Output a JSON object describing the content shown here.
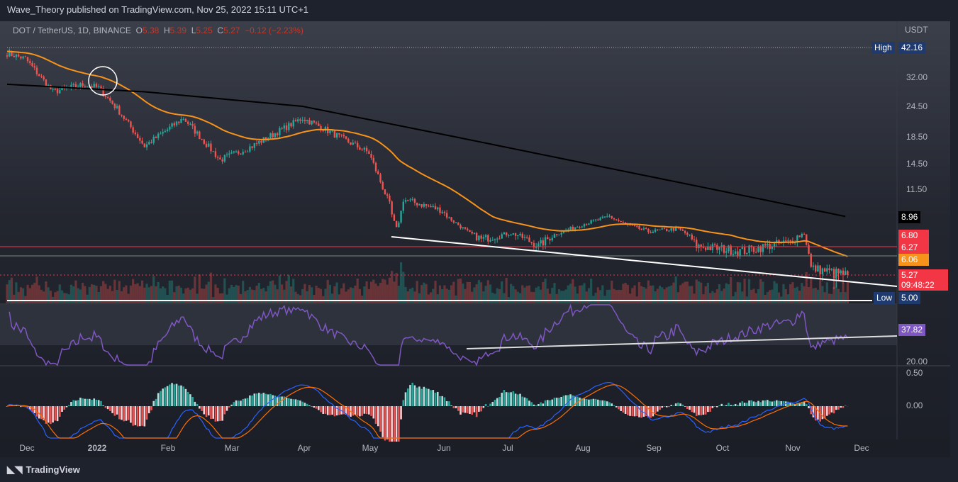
{
  "header": {
    "published": "Wave_Theory published on TradingView.com, Nov 25, 2022 15:11 UTC+1"
  },
  "legend": {
    "symbol": "DOT / TetherUS, 1D, BINANCE",
    "o_label": "O",
    "o": "5.38",
    "h_label": "H",
    "h": "5.39",
    "l_label": "L",
    "l": "5.25",
    "c_label": "C",
    "c": "5.27",
    "change": "−0.12 (−2.23%)"
  },
  "axis": {
    "currency": "USDT",
    "price_ticks": [
      "32.00",
      "24.50",
      "18.50",
      "14.50",
      "11.50"
    ],
    "high_label": "High",
    "high_value": "42.16",
    "low_label": "Low",
    "low_value": "5.00",
    "ma200_value": "8.96",
    "level1": "6.80",
    "level2": "6.27",
    "ma50_value": "6.06",
    "last_price": "5.27",
    "countdown": "09:48:22",
    "rsi_value": "37.82",
    "rsi_tick": "20.00",
    "macd_ticks": [
      "0.50",
      "0.00"
    ],
    "time_ticks": [
      "Dec",
      "2022",
      "Feb",
      "Mar",
      "Apr",
      "May",
      "Jun",
      "Jul",
      "Aug",
      "Sep",
      "Oct",
      "Nov",
      "Dec"
    ]
  },
  "footer": {
    "brand": "TradingView"
  },
  "colors": {
    "up": "#26a69a",
    "down": "#ef5350",
    "ma50": "#f7931a",
    "ma200": "#000000",
    "rsi": "#7e57c2",
    "level": "#f23645"
  },
  "chart_data": {
    "type": "candlestick",
    "title": "DOT / TetherUS, 1D, BINANCE",
    "ylabel": "USDT",
    "yscale": "log",
    "ylim": [
      5.0,
      42.16
    ],
    "x_start": "2021-11-23",
    "x_end": "2022-11-25",
    "close_path": [
      [
        0,
        40
      ],
      [
        8,
        38
      ],
      [
        20,
        28
      ],
      [
        34,
        30
      ],
      [
        40,
        29
      ],
      [
        48,
        24
      ],
      [
        60,
        17
      ],
      [
        77,
        22
      ],
      [
        93,
        15
      ],
      [
        107,
        17
      ],
      [
        129,
        22
      ],
      [
        138,
        20
      ],
      [
        158,
        16
      ],
      [
        167,
        10
      ],
      [
        170,
        7.5
      ],
      [
        173,
        10.5
      ],
      [
        190,
        9.5
      ],
      [
        202,
        7
      ],
      [
        207,
        6.6
      ],
      [
        220,
        7
      ],
      [
        232,
        6.3
      ],
      [
        251,
        8
      ],
      [
        263,
        9
      ],
      [
        270,
        8
      ],
      [
        280,
        7.2
      ],
      [
        293,
        7.5
      ],
      [
        301,
        6.3
      ],
      [
        321,
        6.1
      ],
      [
        342,
        6.5
      ],
      [
        348,
        7
      ],
      [
        351,
        5.5
      ],
      [
        367,
        5.27
      ]
    ],
    "ma200_path": [
      [
        0,
        30
      ],
      [
        60,
        28
      ],
      [
        129,
        24.5
      ],
      [
        250,
        14.7
      ],
      [
        367,
        8.96
      ]
    ],
    "horizontal_levels": [
      6.27,
      6.06,
      5.27,
      5.0
    ],
    "indicators": [
      "Volume",
      "SMA 50",
      "SMA 200",
      "RSI 14",
      "MACD"
    ]
  }
}
